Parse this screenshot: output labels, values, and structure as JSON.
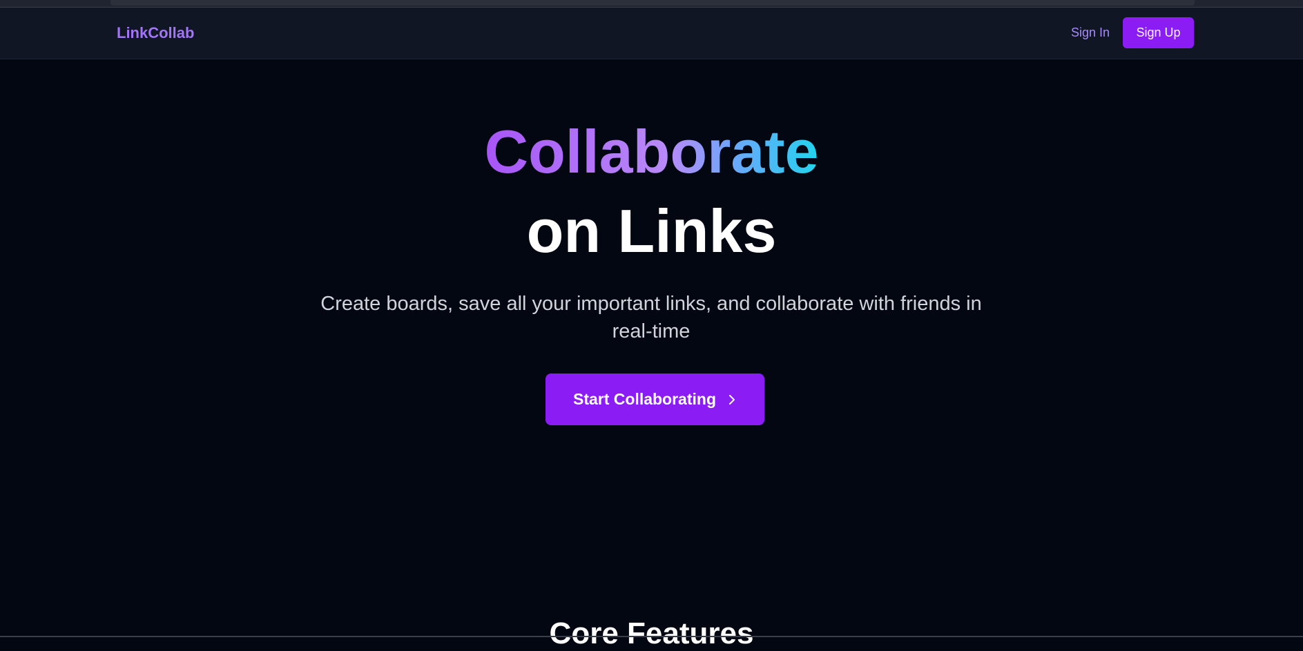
{
  "nav": {
    "logo": "LinkCollab",
    "sign_in": "Sign In",
    "sign_up": "Sign Up"
  },
  "hero": {
    "title_line_1": "Collaborate",
    "title_line_2": "on Links",
    "subtitle": "Create boards, save all your important links, and collaborate with friends in real-time",
    "cta_label": "Start Collaborating",
    "cta_icon": "chevron-right-icon"
  },
  "features": {
    "title": "Core Features"
  },
  "colors": {
    "background": "#030712",
    "navbar": "#101624",
    "accent": "#8b1cf4",
    "logo": "#a275f7",
    "gradient_start": "#a855f7",
    "gradient_end": "#22d3ee"
  }
}
